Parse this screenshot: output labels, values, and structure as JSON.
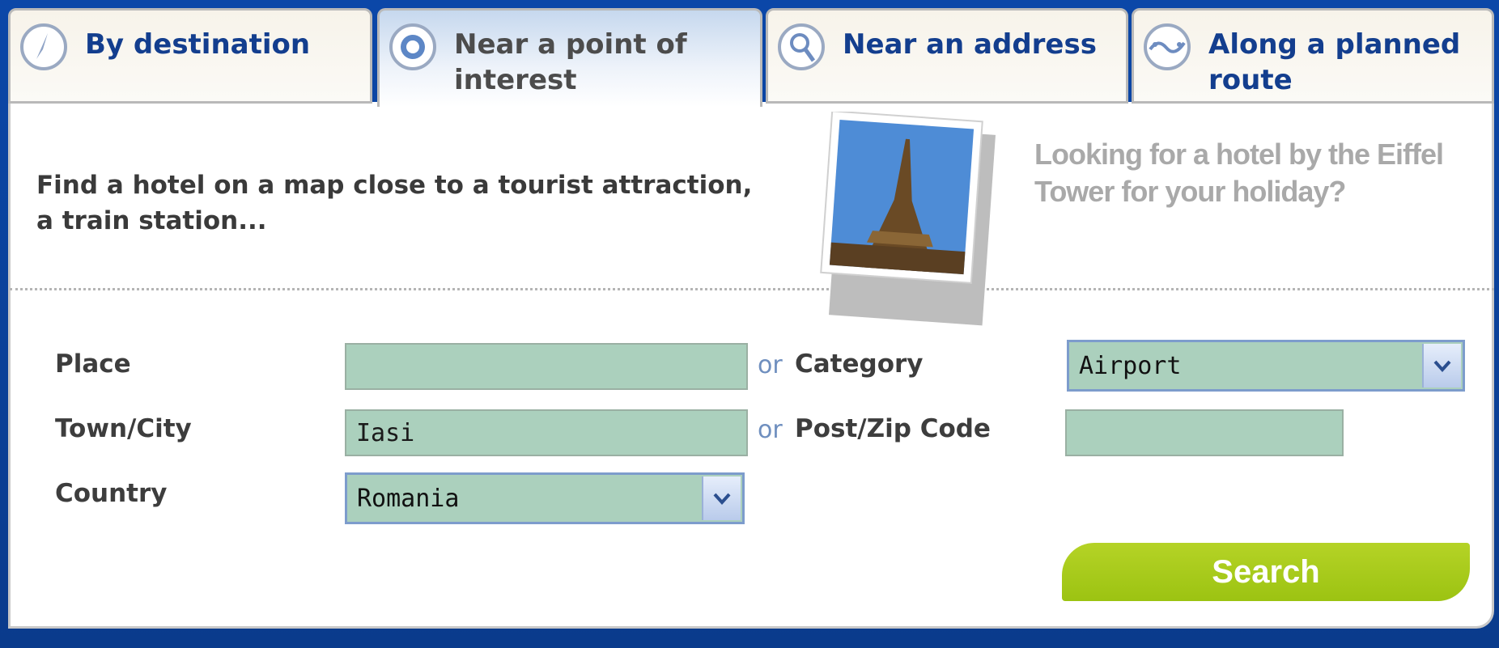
{
  "tabs": [
    {
      "label": "By destination",
      "icon": "compass-needle-icon"
    },
    {
      "label": "Near a point of interest",
      "icon": "target-icon"
    },
    {
      "label": "Near an address",
      "icon": "magnifier-icon"
    },
    {
      "label": "Along a planned route",
      "icon": "route-icon"
    }
  ],
  "active_tab": "Near a point of interest",
  "intro_text": "Find a hotel on a map close to a tourist attraction, a train station...",
  "promo_text": "Looking for a hotel by the Eiffel Tower for your holiday?",
  "form": {
    "place_label": "Place",
    "place_value": "",
    "or_1": "or",
    "category_label": "Category",
    "category_value": "Airport",
    "town_label": "Town/City",
    "town_value": "Iasi",
    "or_2": "or",
    "zip_label": "Post/Zip Code",
    "zip_value": "",
    "country_label": "Country",
    "country_value": "Romania"
  },
  "search_label": "Search",
  "colors": {
    "tab_text": "#133e8e",
    "field_bg": "#abd0bd",
    "search_button": "#a8cc1c",
    "promo_text": "#a9a9a9"
  }
}
